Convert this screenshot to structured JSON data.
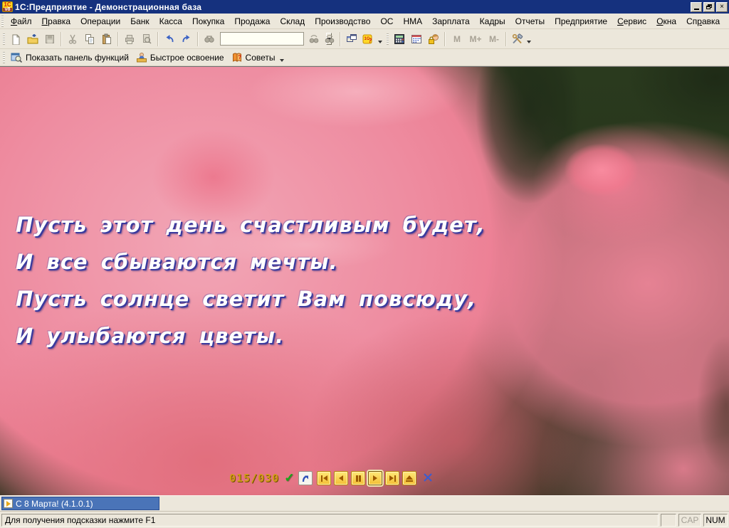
{
  "window": {
    "title": "1С:Предприятие - Демонстрационная база",
    "app_icon_top": "1С",
    "app_icon_bottom": "v8"
  },
  "menu": {
    "items": [
      {
        "label": "Файл",
        "accel": "Ф"
      },
      {
        "label": "Правка",
        "accel": "П"
      },
      {
        "label": "Операции",
        "accel": ""
      },
      {
        "label": "Банк",
        "accel": ""
      },
      {
        "label": "Касса",
        "accel": ""
      },
      {
        "label": "Покупка",
        "accel": ""
      },
      {
        "label": "Продажа",
        "accel": ""
      },
      {
        "label": "Склад",
        "accel": ""
      },
      {
        "label": "Производство",
        "accel": ""
      },
      {
        "label": "ОС",
        "accel": ""
      },
      {
        "label": "НМА",
        "accel": ""
      },
      {
        "label": "Зарплата",
        "accel": ""
      },
      {
        "label": "Кадры",
        "accel": ""
      },
      {
        "label": "Отчеты",
        "accel": ""
      },
      {
        "label": "Предприятие",
        "accel": ""
      },
      {
        "label": "Сервис",
        "accel": "С"
      },
      {
        "label": "Окна",
        "accel": "О"
      },
      {
        "label": "Справка",
        "accel": "р"
      }
    ]
  },
  "toolbar": {
    "combobox_value": "",
    "help_icon_text": "1С?",
    "memory_buttons": [
      "M",
      "M+",
      "M-"
    ]
  },
  "function_bar": {
    "show_panel_label": "Показать панель функций",
    "quick_learn_label": "Быстрое освоение",
    "tips_label": "Советы"
  },
  "main": {
    "poem": {
      "lines": [
        "Пусть этот день счастливым будет,",
        "И все сбываются мечты.",
        "Пусть солнце светит Вам повсюду,",
        "И улыбаются цветы."
      ]
    },
    "player": {
      "counter": "015/030"
    }
  },
  "window_bar": {
    "active_window_label": "С 8 Марта! (4.1.0.1)"
  },
  "status_bar": {
    "hint": "Для получения подсказки нажмите F1",
    "cap": "CAP",
    "num": "NUM"
  },
  "colors": {
    "titlebar_blue": "#15317E",
    "background_beige": "#ECE7DB",
    "selection_blue": "#4A74B8",
    "gold_accent": "#D29B18",
    "rose_pink": "#EE8CA0"
  }
}
